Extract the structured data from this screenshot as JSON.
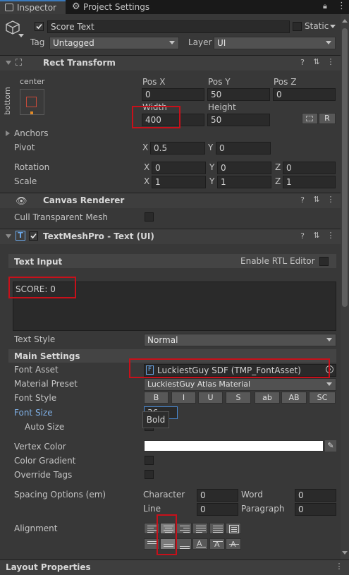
{
  "tabs": [
    {
      "label": "Inspector"
    },
    {
      "label": "Project Settings"
    }
  ],
  "object": {
    "name": "Score Text",
    "static_label": "Static",
    "tag_label": "Tag",
    "tag_value": "Untagged",
    "layer_label": "Layer",
    "layer_value": "UI"
  },
  "rect_transform": {
    "title": "Rect Transform",
    "anchor_h": "center",
    "anchor_v": "bottom",
    "pos_x_label": "Pos X",
    "pos_y_label": "Pos Y",
    "pos_z_label": "Pos Z",
    "pos_x": "0",
    "pos_y": "50",
    "pos_z": "0",
    "width_label": "Width",
    "height_label": "Height",
    "width": "400",
    "height": "50",
    "r_button": "R",
    "anchors_label": "Anchors",
    "pivot_label": "Pivot",
    "pivot_x": "0.5",
    "pivot_y": "0",
    "rotation_label": "Rotation",
    "rot_x": "0",
    "rot_y": "0",
    "rot_z": "0",
    "scale_label": "Scale",
    "scale_x": "1",
    "scale_y": "1",
    "scale_z": "1",
    "x": "X",
    "y": "Y",
    "z": "Z"
  },
  "canvas_renderer": {
    "title": "Canvas Renderer",
    "cull_label": "Cull Transparent Mesh"
  },
  "tmp": {
    "title": "TextMeshPro - Text (UI)",
    "text_input_label": "Text Input",
    "rtl_label": "Enable RTL Editor",
    "text_value": "SCORE: 0",
    "text_style_label": "Text Style",
    "text_style_value": "Normal",
    "main_settings_label": "Main Settings",
    "font_asset_label": "Font Asset",
    "font_asset_value": "LuckiestGuy SDF (TMP_FontAsset)",
    "material_preset_label": "Material Preset",
    "material_preset_value": "LuckiestGuy Atlas Material",
    "font_style_label": "Font Style",
    "font_style_buttons": [
      "B",
      "I",
      "U",
      "S",
      "ab",
      "AB",
      "SC"
    ],
    "font_size_label": "Font Size",
    "font_size_value": "36",
    "tooltip": "Bold",
    "auto_size_label": "Auto Size",
    "vertex_color_label": "Vertex Color",
    "color_gradient_label": "Color Gradient",
    "override_tags_label": "Override Tags",
    "spacing_label": "Spacing Options (em)",
    "character_label": "Character",
    "character_value": "0",
    "word_label": "Word",
    "word_value": "0",
    "line_label": "Line",
    "line_value": "0",
    "paragraph_label": "Paragraph",
    "paragraph_value": "0",
    "alignment_label": "Alignment"
  },
  "layout_properties": {
    "title": "Layout Properties"
  },
  "colors": {
    "accent": "#3a79bb",
    "highlight_box": "#c8101a",
    "font_size_label": "#7fb0e6"
  }
}
